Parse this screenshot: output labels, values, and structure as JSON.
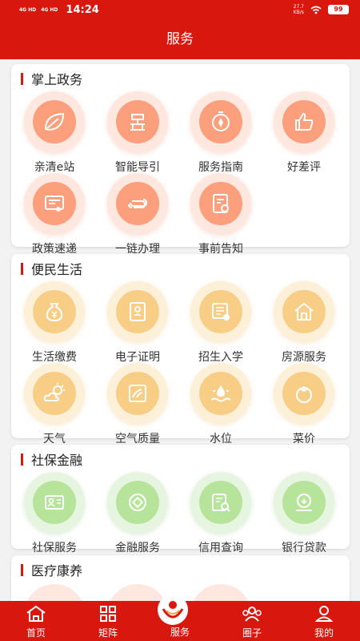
{
  "status": {
    "network1": "4G HD",
    "network2": "4G HD",
    "time": "14:24",
    "speed_value": "27.7",
    "speed_unit": "KB/s",
    "battery": "99"
  },
  "header": {
    "title": "服务"
  },
  "sections": [
    {
      "title": "掌上政务",
      "items": [
        "亲清e站",
        "智能导引",
        "服务指南",
        "好差评",
        "政策速递",
        "一链办理",
        "事前告知"
      ]
    },
    {
      "title": "便民生活",
      "items": [
        "生活缴费",
        "电子证明",
        "招生入学",
        "房源服务",
        "天气",
        "空气质量",
        "水位",
        "菜价"
      ]
    },
    {
      "title": "社保金融",
      "items": [
        "社保服务",
        "金融服务",
        "信用查询",
        "银行贷款"
      ]
    },
    {
      "title": "医疗康养"
    }
  ],
  "colors": {
    "brand_red": "#d8180e",
    "icon_orange": "#fb9f7c",
    "icon_yellow": "#f8cd86",
    "icon_green": "#b6e49a"
  },
  "tabbar": {
    "items": [
      "首页",
      "矩阵",
      "服务",
      "圈子",
      "我的"
    ]
  }
}
